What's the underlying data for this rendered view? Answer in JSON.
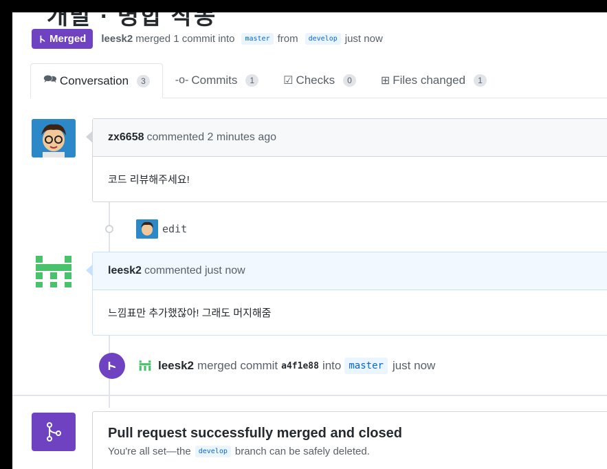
{
  "title_fragment": "개발 · 병합 작동",
  "status": {
    "badge_label": "Merged",
    "user": "leesk2",
    "merged_text": "merged 1 commit into",
    "base_branch": "master",
    "from_text": "from",
    "head_branch": "develop",
    "time": "just now"
  },
  "tabs": [
    {
      "label": "Conversation",
      "count": "3",
      "icon": "comment-discussion-icon"
    },
    {
      "label": "Commits",
      "count": "1",
      "icon": "git-commit-icon"
    },
    {
      "label": "Checks",
      "count": "0",
      "icon": "checklist-icon"
    },
    {
      "label": "Files changed",
      "count": "1",
      "icon": "file-diff-icon"
    }
  ],
  "comments": [
    {
      "author": "zx6658",
      "action": "commented 2 minutes ago",
      "body": "코드 리뷰해주세요!"
    },
    {
      "author": "leesk2",
      "action": "commented just now",
      "body": "느낌표만 추가했잖아! 그래도 머지해줌"
    }
  ],
  "commit": {
    "message": "edit"
  },
  "merge_event": {
    "user": "leesk2",
    "text": "merged commit",
    "sha": "a4f1e88",
    "into_text": "into",
    "branch": "master",
    "time": "just now"
  },
  "merge_box": {
    "title": "Pull request successfully merged and closed",
    "sub_prefix": "You're all set—the",
    "branch": "develop",
    "sub_suffix": "branch can be safely deleted."
  },
  "colors": {
    "merged_purple": "#6f42c1",
    "link_blue": "#0366d6",
    "identicon_green": "#4ac26b"
  }
}
